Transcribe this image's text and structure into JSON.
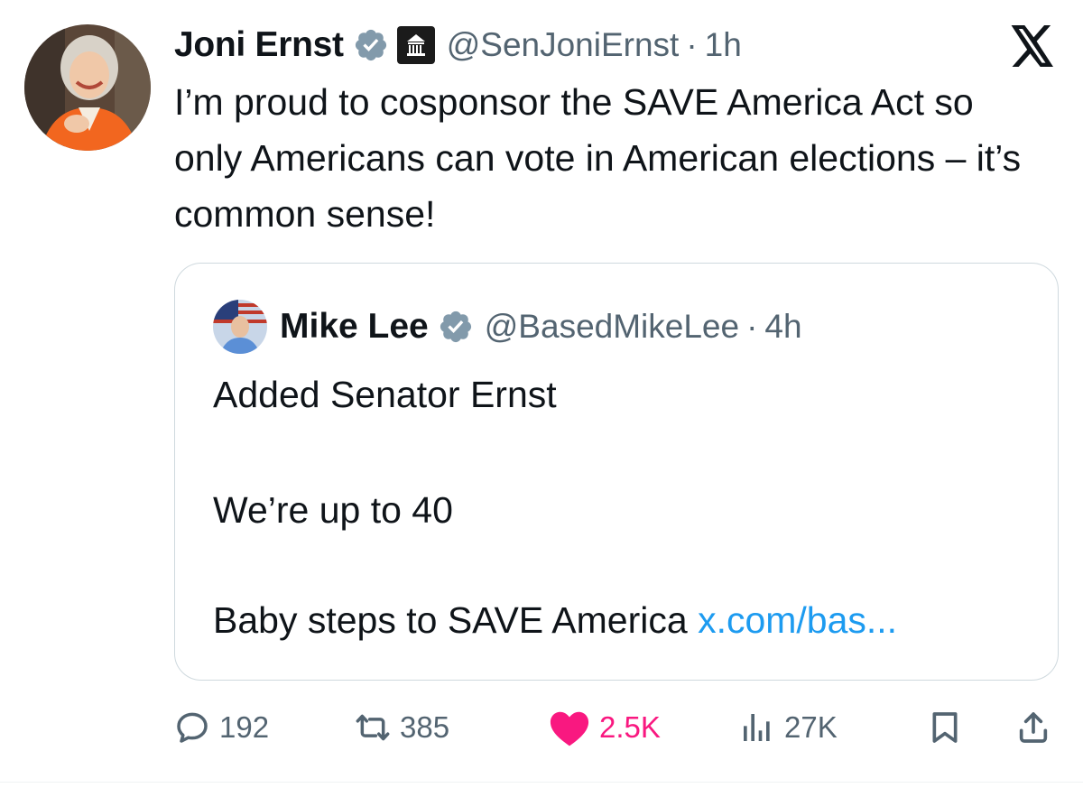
{
  "tweet": {
    "author": {
      "name": "Joni Ernst",
      "handle": "@SenJoniErnst",
      "time": "1h",
      "verified_color": "#829aab",
      "badge": "government-building-icon"
    },
    "text": "I’m proud to cosponsor the SAVE America Act so only Americans can vote in American elections – it’s common sense!"
  },
  "quote": {
    "author": {
      "name": "Mike Lee",
      "handle": "@BasedMikeLee",
      "time": "4h",
      "verified_color": "#829aab"
    },
    "lines": {
      "line1": "Added Senator Ernst",
      "line2": "We’re up to 40",
      "line3": "Baby steps to SAVE America",
      "link": "x.com/bas..."
    }
  },
  "separator": "·",
  "actions": {
    "replies": "192",
    "reposts": "385",
    "likes": "2.5K",
    "views": "27K"
  },
  "colors": {
    "text": "#0f1419",
    "secondary": "#536471",
    "link": "#1d9bf0",
    "like": "#f91880",
    "border": "#cfd9de"
  },
  "icons": [
    "x-logo-icon",
    "verified-badge-icon",
    "reply-icon",
    "repost-icon",
    "heart-icon",
    "views-icon",
    "bookmark-icon",
    "share-icon"
  ]
}
